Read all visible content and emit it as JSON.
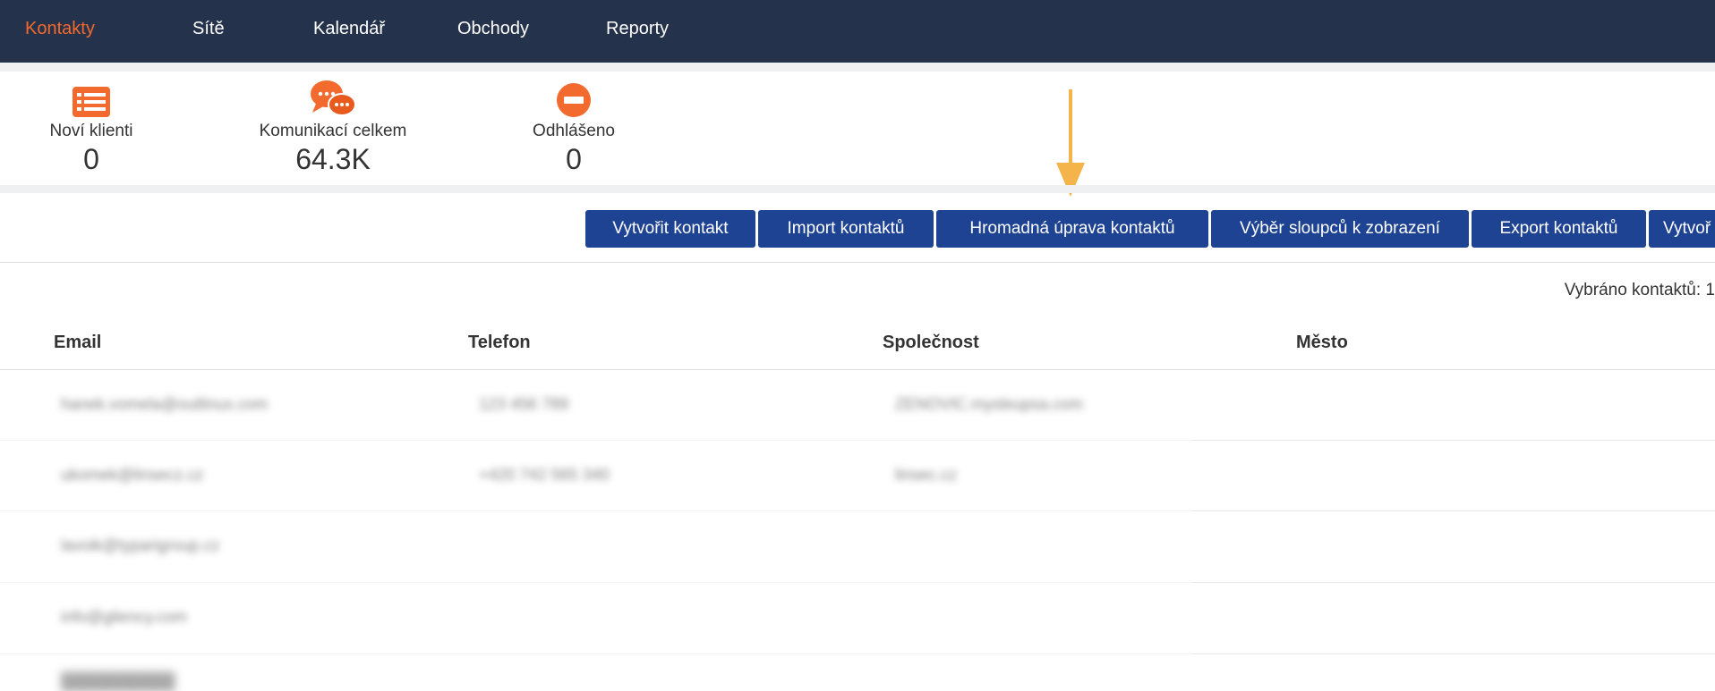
{
  "nav": {
    "items": [
      {
        "label": "Kontakty",
        "active": true
      },
      {
        "label": "Sítě"
      },
      {
        "label": "Kalendář"
      },
      {
        "label": "Obchody"
      },
      {
        "label": "Reporty"
      }
    ]
  },
  "stats": [
    {
      "icon": "list-icon",
      "label": "Noví klienti",
      "value": "0"
    },
    {
      "icon": "chat-bubbles-icon",
      "label": "Komunikací celkem",
      "value": "64.3K"
    },
    {
      "icon": "minus-circle-icon",
      "label": "Odhlášeno",
      "value": "0"
    }
  ],
  "toolbar": {
    "buttons": [
      "Vytvořit kontakt",
      "Import kontaktů",
      "Hromadná úprava kontaktů",
      "Výběr sloupců k zobrazení",
      "Export kontaktů",
      "Vytvoř"
    ],
    "selected_count": "Vybráno kontaktů: 1"
  },
  "table": {
    "columns": [
      "Email",
      "Telefon",
      "Společnost",
      "Město"
    ],
    "rows": [
      {
        "email": "hanek.vomela@outlinux.com",
        "phone": "123 456 789",
        "company": "ZENOVIC.mysleupsa.com"
      },
      {
        "email": "ukomek@linsecz.cz",
        "phone": "+420 742 565 340",
        "company": "linsec.cz"
      },
      {
        "email": "lavoik@typarigroup.cz",
        "phone": "",
        "company": ""
      },
      {
        "email": "info@gliency.com",
        "phone": "",
        "company": ""
      }
    ]
  },
  "colors": {
    "nav_bg": "#25324b",
    "accent": "#f26a2e",
    "button_bg": "#1e4393",
    "arrow": "#f5b44a"
  }
}
